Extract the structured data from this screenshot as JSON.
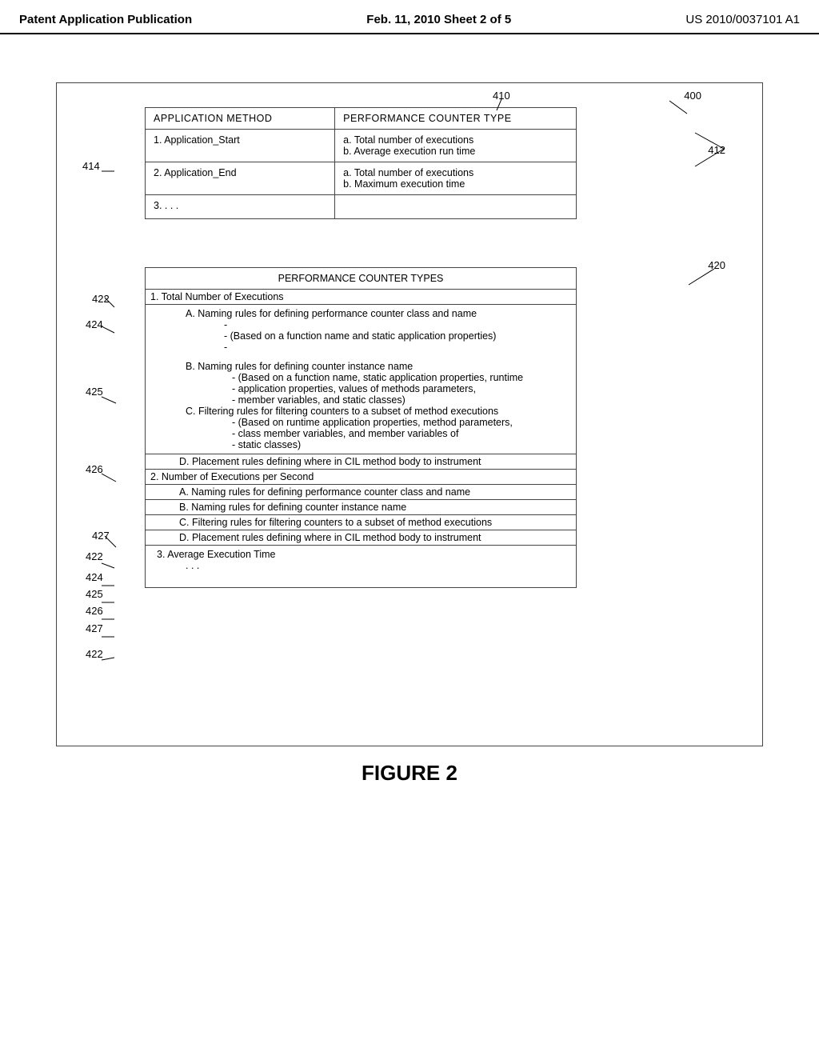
{
  "header": {
    "left": "Patent Application Publication",
    "center": "Feb. 11, 2010   Sheet 2 of 5",
    "right": "US 2010/0037101 A1"
  },
  "figure_caption": "FIGURE 2",
  "table400": {
    "col_method": "APPLICATION METHOD",
    "col_counter": "PERFORMANCE COUNTER TYPE",
    "rows": [
      {
        "method": "1.  Application_Start",
        "ctr_a": "a.  Total number of executions",
        "ctr_b": "b.  Average execution run time"
      },
      {
        "method": "2.  Application_End",
        "ctr_a": "a.  Total number of executions",
        "ctr_b": "b.  Maximum execution time"
      },
      {
        "method": "3.  .  .  .",
        "ctr_a": "",
        "ctr_b": ""
      }
    ]
  },
  "types_box": {
    "title": "PERFORMANCE COUNTER TYPES",
    "item1": "1.  Total Number of Executions",
    "item1A": "A.  Naming rules for defining performance counter class and name",
    "item1A_d1": "-",
    "item1A_d2": "-  (Based on a function name and static application properties)",
    "item1A_d3": "-",
    "item1B": "B.  Naming rules for defining counter instance name",
    "item1B_d1": "-  (Based on a function name, static application properties, runtime",
    "item1B_d2": "-  application properties, values of methods parameters,",
    "item1B_d3": "-  member variables, and static classes)",
    "item1C": "C.  Filtering rules for filtering counters to a subset of method executions",
    "item1C_d1": "-  (Based on runtime application properties, method parameters,",
    "item1C_d2": "-  class member variables, and member variables of",
    "item1C_d3": "-  static classes)",
    "item1D": "D.  Placement rules defining where in CIL method body to instrument",
    "item2": "2.  Number of Executions per Second",
    "item2A": "A.  Naming rules for defining performance counter class and name",
    "item2B": "B.  Naming rules for defining counter instance name",
    "item2C": "C.  Filtering rules for filtering counters to a subset of method executions",
    "item2D": "D.  Placement rules defining where in CIL method body to instrument",
    "item3": "3.  Average Execution Time",
    "item3_dots": ".  .  ."
  },
  "refs": {
    "r400": "400",
    "r410": "410",
    "r412": "412",
    "r414": "414",
    "r420": "420",
    "r422a": "422",
    "r424a": "424",
    "r425a": "425",
    "r426a": "426",
    "r427a": "427",
    "r422b": "422",
    "r424b": "424",
    "r425b": "425",
    "r426b": "426",
    "r427b": "427",
    "r422c": "422"
  }
}
